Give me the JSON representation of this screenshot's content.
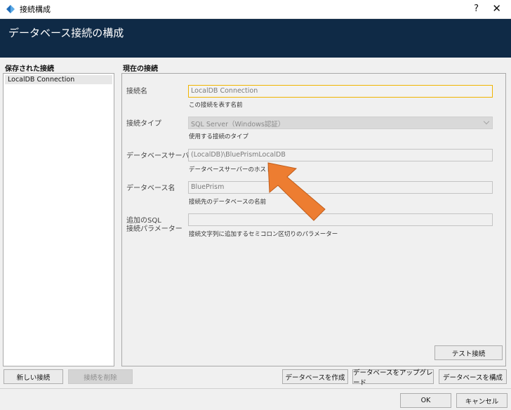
{
  "window": {
    "title": "接続構成",
    "help": "?",
    "close": "✕"
  },
  "header": {
    "title": "データベース接続の構成"
  },
  "saved": {
    "label": "保存された接続",
    "items": [
      "LocalDB Connection"
    ]
  },
  "current": {
    "label": "現在の接続",
    "name": {
      "label": "接続名",
      "value": "LocalDB Connection",
      "help": "この接続を表す名前"
    },
    "type": {
      "label": "接続タイプ",
      "value": "SQL Server（Windows認証）",
      "help": "使用する接続のタイプ"
    },
    "server": {
      "label": "データベースサーバー",
      "value": "(LocalDB)\\BluePrismLocalDB",
      "help": "データベースサーバーのホスト名"
    },
    "database": {
      "label": "データベース名",
      "value": "BluePrism",
      "help": "接続先のデータベースの名前"
    },
    "extra": {
      "label_line1": "追加のSQL",
      "label_line2": "接続パラメーター",
      "value": "",
      "help": "接続文字列に追加するセミコロン区切りのパラメーター"
    },
    "test_button": "テスト接続"
  },
  "actions": {
    "new": "新しい接続",
    "delete": "接続を削除",
    "create_db": "データベースを作成",
    "upgrade_db": "データベースをアップグレード",
    "configure_db": "データベースを構成"
  },
  "footer": {
    "ok": "OK",
    "cancel": "キャンセル"
  },
  "colors": {
    "header_bg": "#0f2a46",
    "focus_border": "#f0b400",
    "annotation_arrow": "#ed7d31"
  }
}
